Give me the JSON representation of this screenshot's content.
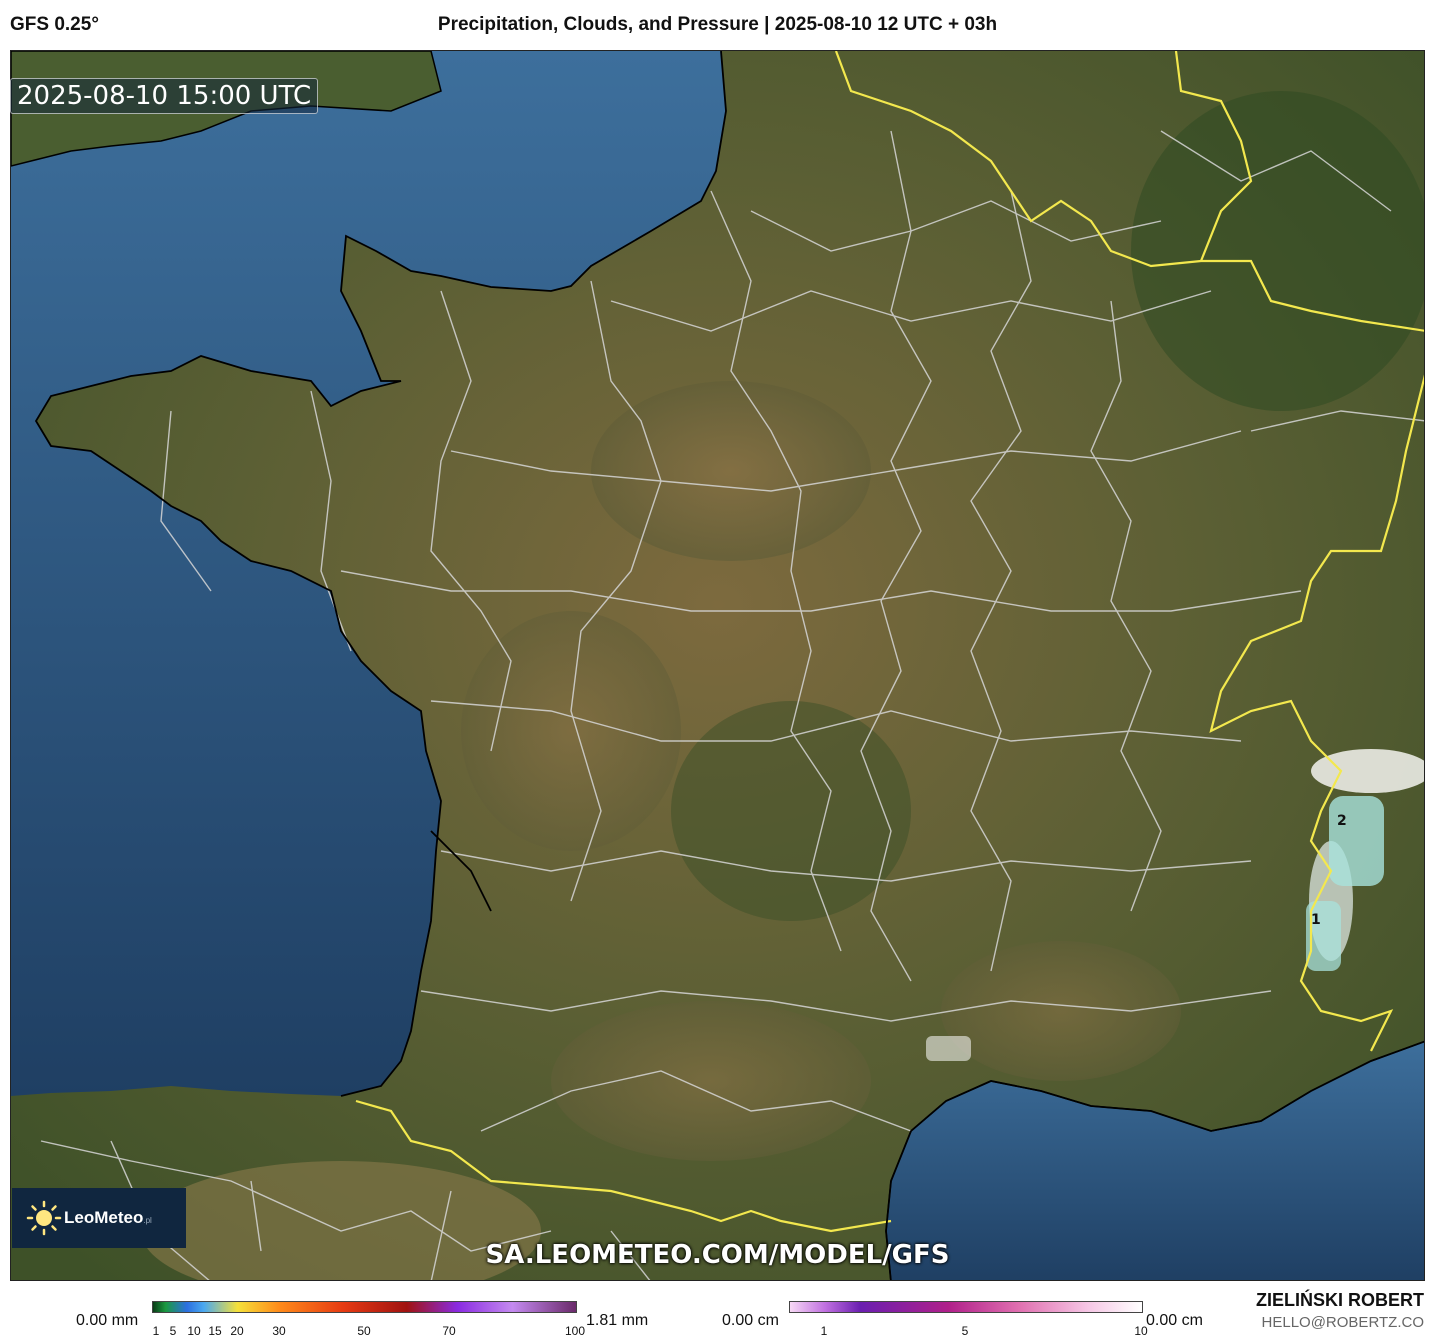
{
  "header": {
    "model": "GFS 0.25°",
    "title": "Precipitation, Clouds, and Pressure | 2025-08-10 12 UTC + 03h"
  },
  "map": {
    "timestamp": "2025-08-10 15:00 UTC",
    "watermark": "SA.LEOMETEO.COM/MODEL/GFS",
    "logo": {
      "name": "LeoMeteo",
      "suffix": ".pl"
    },
    "contour_labels": [
      "2",
      "1"
    ]
  },
  "legend": {
    "precip": {
      "min_label": "0.00 mm",
      "max_label": "1.81 mm",
      "ticks": [
        "1",
        "5",
        "10",
        "15",
        "20",
        "30",
        "50",
        "70",
        "100"
      ]
    },
    "snow": {
      "min_label": "0.00 cm",
      "max_label": "0.00 cm",
      "ticks": [
        "1",
        "5",
        "10"
      ]
    }
  },
  "footer": {
    "author": "ZIELIŃSKI ROBERT",
    "email": "HELLO@ROBERTZ.CO"
  },
  "colors": {
    "sea": "#2f5f8f",
    "land": "#4d5c33",
    "border_country": "#f2e64a",
    "border_region": "#d8d8d8",
    "coast": "#000000"
  }
}
